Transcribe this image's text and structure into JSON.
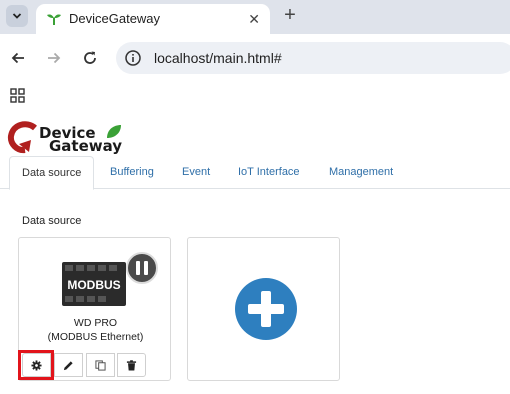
{
  "browser": {
    "tab_title": "DeviceGateway",
    "url": "localhost/main.html#"
  },
  "app": {
    "logo_line1": "Device",
    "logo_line2": "Gateway",
    "nav_tabs": [
      {
        "label": "Data source",
        "active": true
      },
      {
        "label": "Buffering",
        "active": false
      },
      {
        "label": "Event",
        "active": false
      },
      {
        "label": "IoT Interface",
        "active": false
      },
      {
        "label": "Management",
        "active": false
      }
    ],
    "section_title": "Data source",
    "device_card": {
      "image_text": "MODBUS",
      "name": "WD PRO",
      "protocol": "(MODBUS Ethernet)",
      "actions": [
        "settings",
        "edit",
        "copy",
        "delete"
      ]
    }
  },
  "colors": {
    "accent_blue": "#2e7fbf",
    "highlight_red": "#e2141b",
    "tab_link": "#2f6fa8",
    "logo_leaf": "#3aa136",
    "logo_arrow": "#b0201f"
  }
}
